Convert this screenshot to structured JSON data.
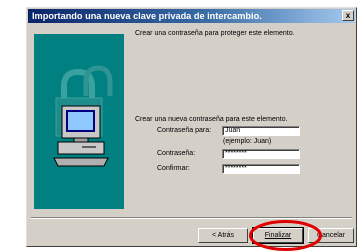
{
  "window": {
    "title": "Importando una nueva clave privada de intercambio.",
    "close_glyph": "x"
  },
  "content": {
    "intro": "Crear una contraseña para proteger este elemento.",
    "section_heading": "Crear una nueva contraseña para este elemento.",
    "password_for_label": "Contraseña para:",
    "password_for_value": "Juan",
    "example_hint": "(ejemplo: Juan)",
    "password_label": "Contraseña:",
    "password_value": "********",
    "confirm_label": "Confirmar:",
    "confirm_value": "********"
  },
  "buttons": {
    "back_label": "< Atrás",
    "finish_label": "Finalizar",
    "cancel_label": "Cancelar"
  },
  "illustration": {
    "icon": "computer-with-padlock-icon"
  },
  "annotation": {
    "icon": "red-ellipse-highlight",
    "color": "#e00000"
  },
  "colors": {
    "titlebar_start": "#0a246a",
    "titlebar_end": "#a6caf0",
    "dialog_face": "#d4d0c8",
    "illustration_bg": "#008080"
  }
}
